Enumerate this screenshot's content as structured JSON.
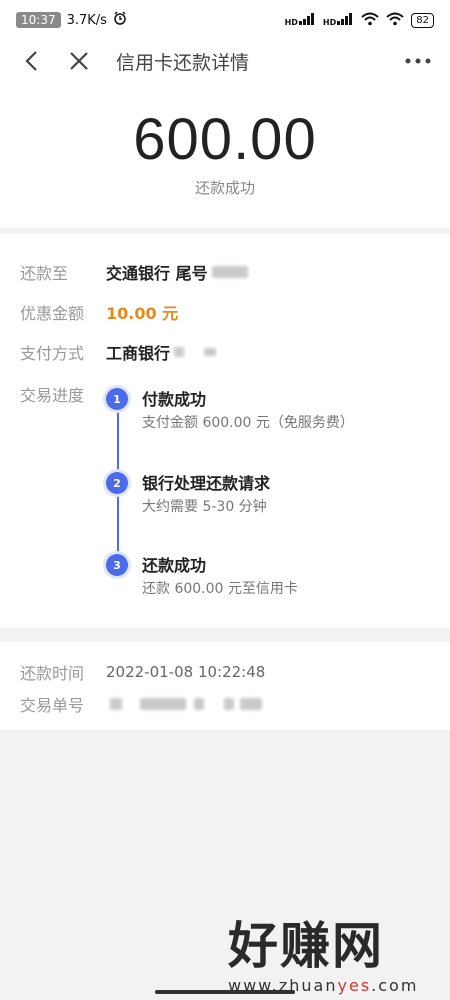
{
  "status_bar": {
    "time": "10:37",
    "net_speed": "3.7K/s",
    "signal1": "HD",
    "signal2": "HD",
    "battery": "82"
  },
  "nav": {
    "title": "信用卡还款详情"
  },
  "hero": {
    "amount": "600.00",
    "status": "还款成功"
  },
  "details": {
    "repay_to_label": "还款至",
    "repay_to_value": "交通银行 尾号",
    "discount_label": "优惠金额",
    "discount_value": "10.00 元",
    "payment_label": "支付方式",
    "payment_value": "工商银行",
    "progress_label": "交易进度",
    "accent_color": "#e8891c",
    "step_color": "#4b6be8"
  },
  "steps": [
    {
      "num": "1",
      "title": "付款成功",
      "desc": "支付金额 600.00 元（免服务费）"
    },
    {
      "num": "2",
      "title": "银行处理还款请求",
      "desc": "大约需要 5-30 分钟"
    },
    {
      "num": "3",
      "title": "还款成功",
      "desc": "还款 600.00 元至信用卡"
    }
  ],
  "meta": {
    "time_label": "还款时间",
    "time_value": "2022-01-08 10:22:48",
    "order_label": "交易单号"
  },
  "watermark": {
    "text": "好赚网",
    "url_a": "www.zhuan",
    "url_b": "yes",
    "url_c": ".com"
  }
}
